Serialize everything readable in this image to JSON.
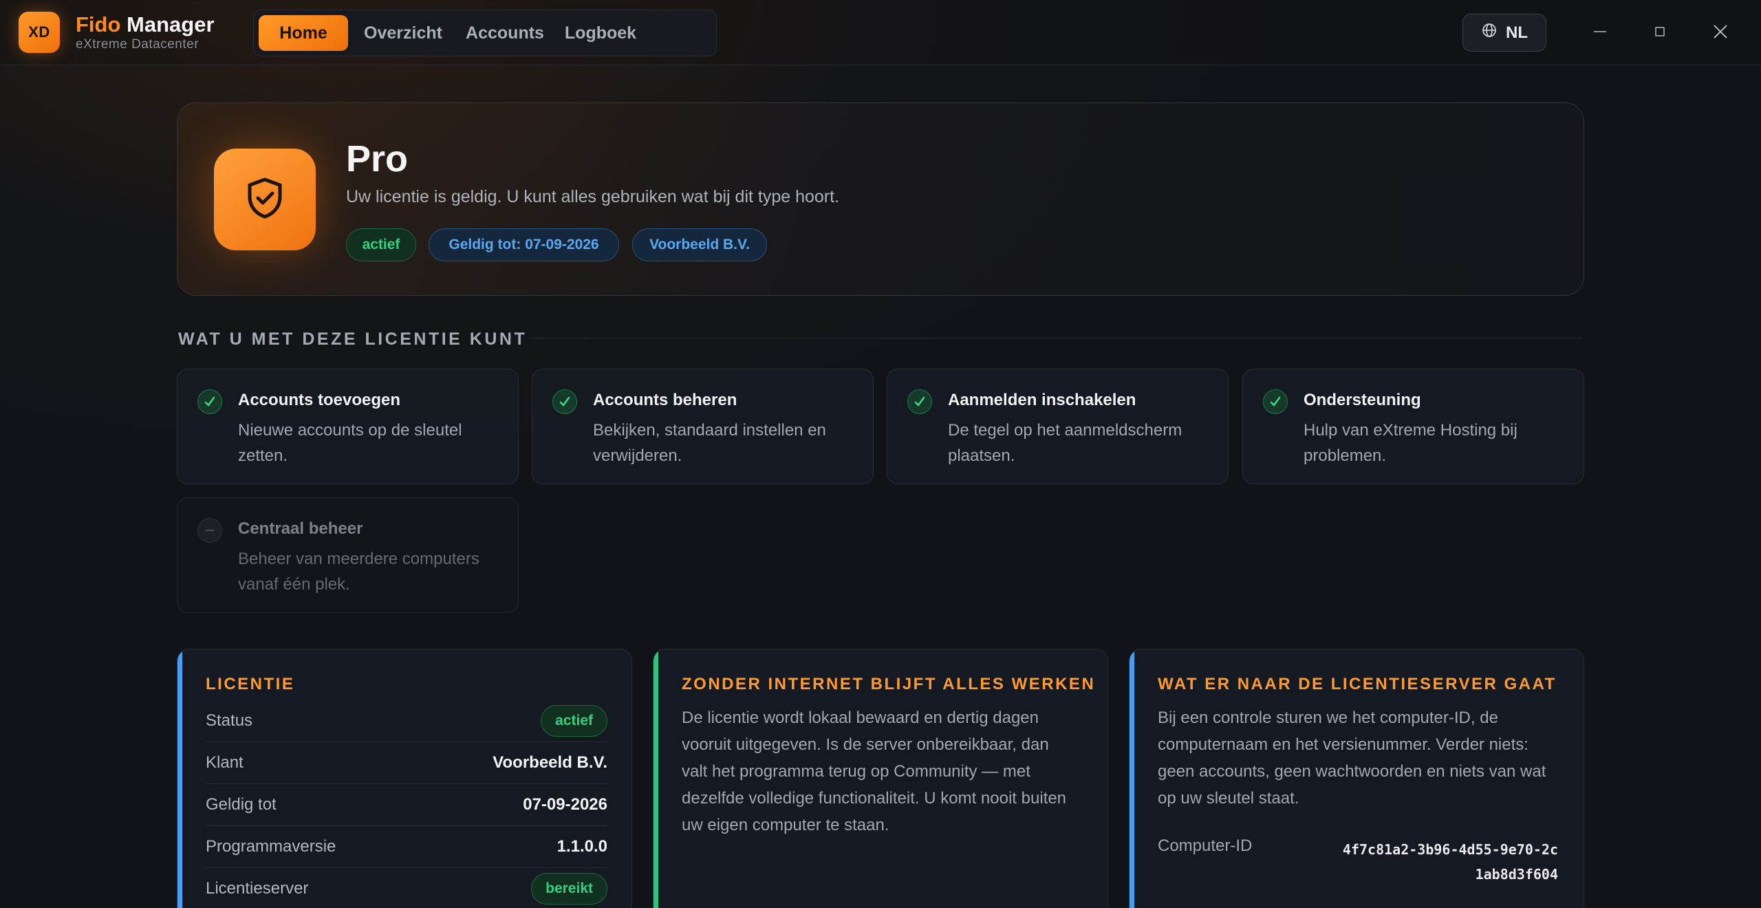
{
  "app": {
    "logo_text": "XD",
    "name_accent": "Fido",
    "name_rest": " Manager",
    "subtitle": "eXtreme Datacenter"
  },
  "nav": {
    "items": [
      {
        "label": "Home",
        "active": true
      },
      {
        "label": "Overzicht",
        "active": false
      },
      {
        "label": "Accounts",
        "active": false
      },
      {
        "label": "Logboek",
        "active": false
      }
    ]
  },
  "language": {
    "label": "NL",
    "icon": "globe-icon"
  },
  "window_controls": [
    "minimize-icon",
    "maximize-icon",
    "close-icon"
  ],
  "hero": {
    "icon": "shield-check-icon",
    "title": "Pro",
    "description": "Uw licentie is geldig. U kunt alles gebruiken wat bij dit type hoort.",
    "badges": {
      "status": "actief",
      "valid_until": "Geldig tot: 07-09-2026",
      "customer": "Voorbeeld B.V."
    }
  },
  "features": {
    "section_title": "WAT U MET DEZE LICENTIE KUNT",
    "items": [
      {
        "title": "Accounts toevoegen",
        "description": "Nieuwe accounts op de sleutel zetten.",
        "enabled": true
      },
      {
        "title": "Accounts beheren",
        "description": "Bekijken, standaard instellen en verwijderen.",
        "enabled": true
      },
      {
        "title": "Aanmelden inschakelen",
        "description": "De tegel op het aanmeldscherm plaatsen.",
        "enabled": true
      },
      {
        "title": "Ondersteuning",
        "description": "Hulp van eXtreme Hosting bij problemen.",
        "enabled": true
      },
      {
        "title": "Centraal beheer",
        "description": "Beheer van meerdere computers vanaf één plek.",
        "enabled": false
      }
    ]
  },
  "license_card": {
    "title": "LICENTIE",
    "rows": {
      "status": {
        "label": "Status",
        "value": "actief"
      },
      "customer": {
        "label": "Klant",
        "value": "Voorbeeld B.V."
      },
      "valid_until": {
        "label": "Geldig tot",
        "value": "07-09-2026"
      },
      "version": {
        "label": "Programmaversie",
        "value": "1.1.0.0"
      },
      "server": {
        "label": "Licentieserver",
        "value": "bereikt"
      }
    }
  },
  "offline_card": {
    "title": "ZONDER INTERNET BLIJFT ALLES WERKEN",
    "text": "De licentie wordt lokaal bewaard en dertig dagen vooruit uitgegeven. Is de server onbereikbaar, dan valt het programma terug op Community — met dezelfde volledige functionaliteit. U komt nooit buiten uw eigen computer te staan."
  },
  "privacy_card": {
    "title": "WAT ER NAAR DE LICENTIESERVER GAAT",
    "text": "Bij een controle sturen we het computer-ID, de computernaam en het versienummer. Verder niets: geen accounts, geen wachtwoorden en niets van wat op uw sleutel staat.",
    "computer_id_label": "Computer-ID",
    "computer_id_value": "4f7c81a2-3b96-4d55-9e70-2c1ab8d3f604"
  },
  "colors": {
    "accent": "#ff8c1f",
    "success": "#35d07f",
    "info": "#5aa9f0",
    "background": "#101318"
  }
}
